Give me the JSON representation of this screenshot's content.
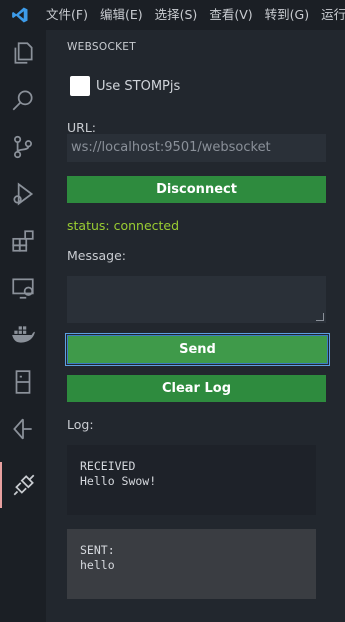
{
  "menu": [
    "文件(F)",
    "编辑(E)",
    "选择(S)",
    "查看(V)",
    "转到(G)",
    "运行"
  ],
  "activity_icons": [
    "explorer-icon",
    "search-icon",
    "source-control-icon",
    "run-debug-icon",
    "extensions-icon",
    "remote-explorer-icon",
    "docker-icon",
    "database-icon",
    "gitlens-icon",
    "websocket-plugin-icon"
  ],
  "panel": {
    "title": "WEBSOCKET",
    "use_stomp_label": "Use STOMPjs",
    "url_label": "URL:",
    "url_value": "ws://localhost:9501/websocket",
    "disconnect_label": "Disconnect",
    "status_text": "status: connected",
    "message_label": "Message:",
    "message_value": "",
    "send_label": "Send",
    "clear_label": "Clear Log",
    "log_label": "Log:"
  },
  "log": [
    {
      "type": "RECEIVED",
      "text": "Hello Swow!"
    },
    {
      "type": "SENT:",
      "text": "hello"
    }
  ],
  "colors": {
    "accent_green": "#2e8b3e",
    "status_green": "#9acd32",
    "focus_blue": "#3c7cc4",
    "vscode_blue": "#3d9be9"
  }
}
